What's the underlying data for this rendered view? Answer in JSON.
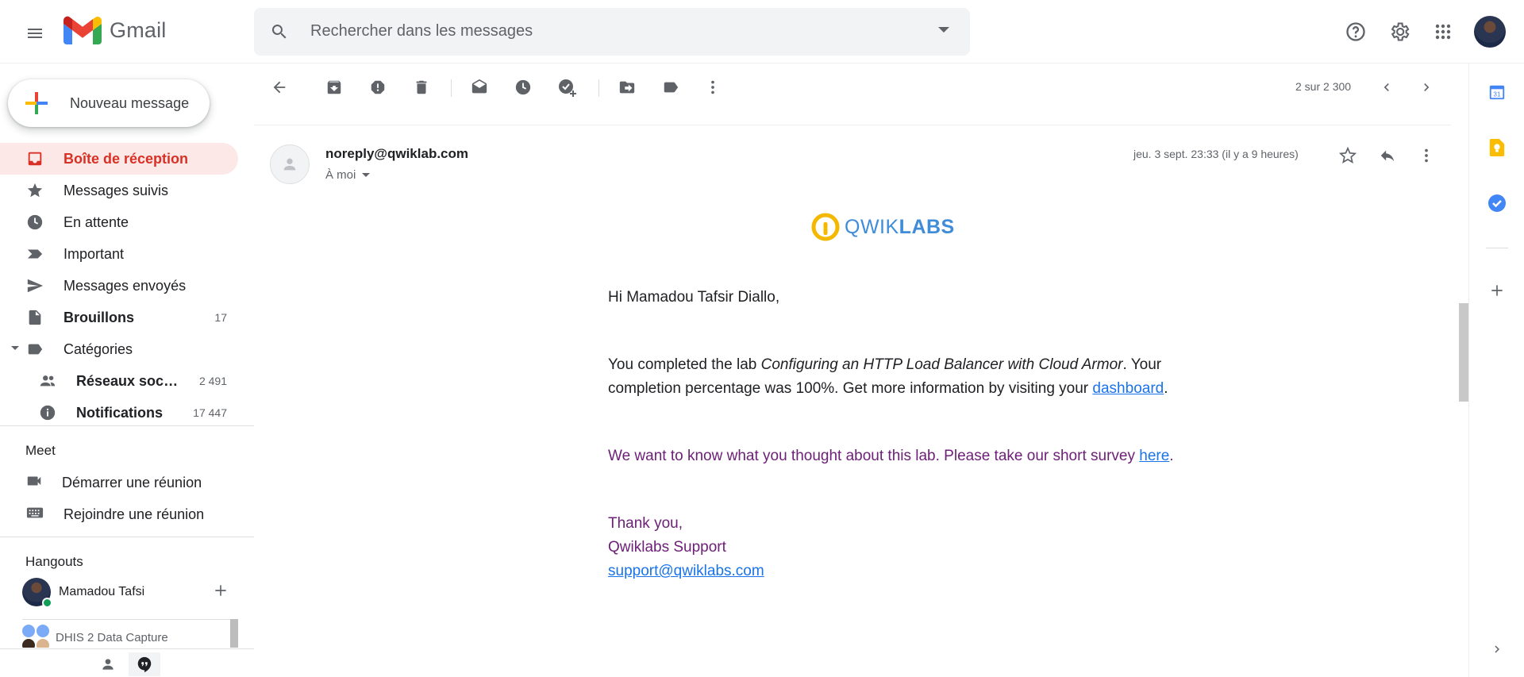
{
  "app": {
    "name": "Gmail"
  },
  "search": {
    "placeholder": "Rechercher dans les messages"
  },
  "compose": {
    "label": "Nouveau message"
  },
  "sidebar": {
    "items": [
      {
        "label": "Boîte de réception",
        "count": ""
      },
      {
        "label": "Messages suivis",
        "count": ""
      },
      {
        "label": "En attente",
        "count": ""
      },
      {
        "label": "Important",
        "count": ""
      },
      {
        "label": "Messages envoyés",
        "count": ""
      },
      {
        "label": "Brouillons",
        "count": "17"
      },
      {
        "label": "Catégories",
        "count": ""
      },
      {
        "label": "Réseaux sociaux",
        "count": "2 491"
      },
      {
        "label": "Notifications",
        "count": "17 447"
      }
    ]
  },
  "meet": {
    "title": "Meet",
    "start": "Démarrer une réunion",
    "join": "Rejoindre une réunion"
  },
  "hangouts": {
    "title": "Hangouts",
    "user": "Mamadou Tafsi",
    "group": "DHIS 2 Data Capture"
  },
  "toolbar": {
    "pager": "2 sur 2 300"
  },
  "message": {
    "sender": "noreply@qwiklab.com",
    "to": "À moi",
    "date": "jeu. 3 sept. 23:33 (il y a 9 heures)",
    "brand_a": "QWIK",
    "brand_b": "LABS",
    "greeting": "Hi Mamadou Tafsir Diallo,",
    "p1_pre": "You completed the lab ",
    "p1_lab": "Configuring an HTTP Load Balancer with Cloud Armor",
    "p1_post": ". Your completion percentage was 100%. Get more information by visiting your ",
    "p1_link": "dashboard",
    "p1_end": ".",
    "p2_pre": "We want to know what you thought about this lab. Please take our short survey ",
    "p2_link": "here",
    "p2_end": ".",
    "thanks": "Thank you,",
    "team": "Qwiklabs Support",
    "support_email": "support@qwiklabs.com"
  },
  "colors": {
    "accent_red": "#d93025",
    "link_blue": "#1a73e8",
    "purple_text": "#6d2077",
    "active_bg": "#fce8e6"
  },
  "icons": [
    "menu-icon",
    "gmail-logo",
    "search-icon",
    "help-icon",
    "settings-icon",
    "apps-icon",
    "back-icon",
    "archive-icon",
    "spam-icon",
    "delete-icon",
    "mark-unread-icon",
    "snooze-icon",
    "add-task-icon",
    "move-to-icon",
    "label-icon",
    "more-icon",
    "star-icon",
    "reply-icon",
    "calendar-icon",
    "keep-icon",
    "tasks-icon",
    "add-icon"
  ]
}
